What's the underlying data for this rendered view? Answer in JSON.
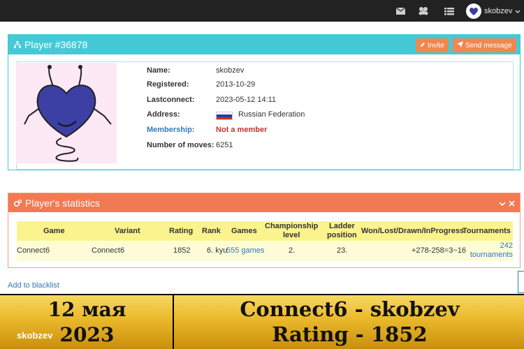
{
  "navbar": {
    "icons": [
      "envelope-icon",
      "users-icon",
      "list-icon"
    ],
    "username": "skobzev"
  },
  "player_panel": {
    "title": "Player #36878",
    "invite_label": "Invite",
    "send_message_label": "Send message",
    "fields": {
      "name_label": "Name:",
      "name": "skobzev",
      "registered_label": "Registered:",
      "registered": "2013-10-29",
      "lastconnect_label": "Lastconnect:",
      "lastconnect": "2023-05-12 14:11",
      "address_label": "Address:",
      "address": "Russian Federation",
      "membership_label": "Membership:",
      "membership": "Not a member",
      "moves_label": "Number of moves:",
      "moves": "6251"
    }
  },
  "stats_panel": {
    "title": "Player's statistics",
    "columns": {
      "game": "Game",
      "variant": "Variant",
      "rating": "Rating",
      "rank": "Rank",
      "games": "Games",
      "championship_1": "Championship",
      "championship_2": "level",
      "ladder_1": "Ladder",
      "ladder_2": "position",
      "wldi": "Won/Lost/Drawn/InProgress",
      "tournaments": "Tournaments"
    },
    "row": {
      "game": "Connect6",
      "variant": "Connect6",
      "rating": "1852",
      "rank": "6. kyu",
      "games": "555 games",
      "championship": "2.",
      "ladder": "23.",
      "wldi": "+278-258=3~16",
      "tournaments_1": "242",
      "tournaments_2": "tournaments"
    }
  },
  "blacklist_label": "Add to blacklist",
  "banner": {
    "date_line1": "12 мая",
    "date_line2": "2023",
    "username": "skobzev",
    "line1": "Connect6 - skobzev",
    "line2": "Rating - 1852"
  },
  "colors": {
    "navbar": "#222222",
    "player_header": "#46c9d6",
    "stats_header": "#f27a52",
    "button": "#f0874f",
    "table_header": "#fbf38d",
    "link": "#337ab7",
    "danger": "#c9302c"
  }
}
